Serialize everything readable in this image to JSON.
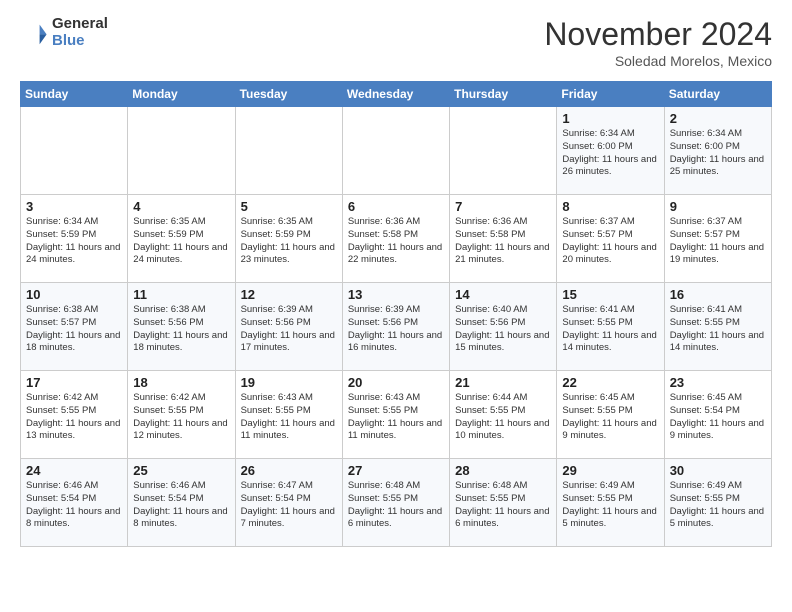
{
  "header": {
    "logo_general": "General",
    "logo_blue": "Blue",
    "month_title": "November 2024",
    "subtitle": "Soledad Morelos, Mexico"
  },
  "weekdays": [
    "Sunday",
    "Monday",
    "Tuesday",
    "Wednesday",
    "Thursday",
    "Friday",
    "Saturday"
  ],
  "weeks": [
    [
      {
        "day": "",
        "info": ""
      },
      {
        "day": "",
        "info": ""
      },
      {
        "day": "",
        "info": ""
      },
      {
        "day": "",
        "info": ""
      },
      {
        "day": "",
        "info": ""
      },
      {
        "day": "1",
        "info": "Sunrise: 6:34 AM\nSunset: 6:00 PM\nDaylight: 11 hours and 26 minutes."
      },
      {
        "day": "2",
        "info": "Sunrise: 6:34 AM\nSunset: 6:00 PM\nDaylight: 11 hours and 25 minutes."
      }
    ],
    [
      {
        "day": "3",
        "info": "Sunrise: 6:34 AM\nSunset: 5:59 PM\nDaylight: 11 hours and 24 minutes."
      },
      {
        "day": "4",
        "info": "Sunrise: 6:35 AM\nSunset: 5:59 PM\nDaylight: 11 hours and 24 minutes."
      },
      {
        "day": "5",
        "info": "Sunrise: 6:35 AM\nSunset: 5:59 PM\nDaylight: 11 hours and 23 minutes."
      },
      {
        "day": "6",
        "info": "Sunrise: 6:36 AM\nSunset: 5:58 PM\nDaylight: 11 hours and 22 minutes."
      },
      {
        "day": "7",
        "info": "Sunrise: 6:36 AM\nSunset: 5:58 PM\nDaylight: 11 hours and 21 minutes."
      },
      {
        "day": "8",
        "info": "Sunrise: 6:37 AM\nSunset: 5:57 PM\nDaylight: 11 hours and 20 minutes."
      },
      {
        "day": "9",
        "info": "Sunrise: 6:37 AM\nSunset: 5:57 PM\nDaylight: 11 hours and 19 minutes."
      }
    ],
    [
      {
        "day": "10",
        "info": "Sunrise: 6:38 AM\nSunset: 5:57 PM\nDaylight: 11 hours and 18 minutes."
      },
      {
        "day": "11",
        "info": "Sunrise: 6:38 AM\nSunset: 5:56 PM\nDaylight: 11 hours and 18 minutes."
      },
      {
        "day": "12",
        "info": "Sunrise: 6:39 AM\nSunset: 5:56 PM\nDaylight: 11 hours and 17 minutes."
      },
      {
        "day": "13",
        "info": "Sunrise: 6:39 AM\nSunset: 5:56 PM\nDaylight: 11 hours and 16 minutes."
      },
      {
        "day": "14",
        "info": "Sunrise: 6:40 AM\nSunset: 5:56 PM\nDaylight: 11 hours and 15 minutes."
      },
      {
        "day": "15",
        "info": "Sunrise: 6:41 AM\nSunset: 5:55 PM\nDaylight: 11 hours and 14 minutes."
      },
      {
        "day": "16",
        "info": "Sunrise: 6:41 AM\nSunset: 5:55 PM\nDaylight: 11 hours and 14 minutes."
      }
    ],
    [
      {
        "day": "17",
        "info": "Sunrise: 6:42 AM\nSunset: 5:55 PM\nDaylight: 11 hours and 13 minutes."
      },
      {
        "day": "18",
        "info": "Sunrise: 6:42 AM\nSunset: 5:55 PM\nDaylight: 11 hours and 12 minutes."
      },
      {
        "day": "19",
        "info": "Sunrise: 6:43 AM\nSunset: 5:55 PM\nDaylight: 11 hours and 11 minutes."
      },
      {
        "day": "20",
        "info": "Sunrise: 6:43 AM\nSunset: 5:55 PM\nDaylight: 11 hours and 11 minutes."
      },
      {
        "day": "21",
        "info": "Sunrise: 6:44 AM\nSunset: 5:55 PM\nDaylight: 11 hours and 10 minutes."
      },
      {
        "day": "22",
        "info": "Sunrise: 6:45 AM\nSunset: 5:55 PM\nDaylight: 11 hours and 9 minutes."
      },
      {
        "day": "23",
        "info": "Sunrise: 6:45 AM\nSunset: 5:54 PM\nDaylight: 11 hours and 9 minutes."
      }
    ],
    [
      {
        "day": "24",
        "info": "Sunrise: 6:46 AM\nSunset: 5:54 PM\nDaylight: 11 hours and 8 minutes."
      },
      {
        "day": "25",
        "info": "Sunrise: 6:46 AM\nSunset: 5:54 PM\nDaylight: 11 hours and 8 minutes."
      },
      {
        "day": "26",
        "info": "Sunrise: 6:47 AM\nSunset: 5:54 PM\nDaylight: 11 hours and 7 minutes."
      },
      {
        "day": "27",
        "info": "Sunrise: 6:48 AM\nSunset: 5:55 PM\nDaylight: 11 hours and 6 minutes."
      },
      {
        "day": "28",
        "info": "Sunrise: 6:48 AM\nSunset: 5:55 PM\nDaylight: 11 hours and 6 minutes."
      },
      {
        "day": "29",
        "info": "Sunrise: 6:49 AM\nSunset: 5:55 PM\nDaylight: 11 hours and 5 minutes."
      },
      {
        "day": "30",
        "info": "Sunrise: 6:49 AM\nSunset: 5:55 PM\nDaylight: 11 hours and 5 minutes."
      }
    ]
  ]
}
